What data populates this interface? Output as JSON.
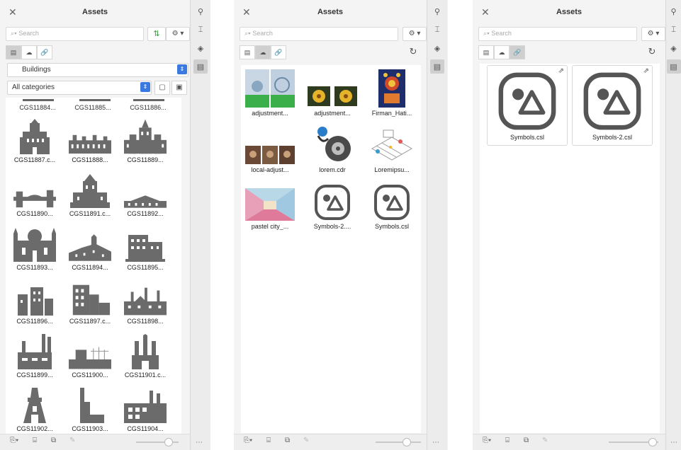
{
  "panels": [
    {
      "title": "Assets",
      "search_placeholder": "Search",
      "library_dropdown": "Buildings",
      "category_dropdown": "All categories",
      "header_row_labels": [
        "CGS11884...",
        "CGS11885...",
        "CGS11886..."
      ],
      "items": [
        "CGS11887.c...",
        "CGS11888...",
        "CGS11889...",
        "CGS11890...",
        "CGS11891.c...",
        "CGS11892...",
        "CGS11893...",
        "CGS11894...",
        "CGS11895...",
        "CGS11896...",
        "CGS11897.c...",
        "CGS11898...",
        "CGS11899...",
        "CGS11900...",
        "CGS11901.c...",
        "CGS11902...",
        "CGS11903...",
        "CGS11904..."
      ]
    },
    {
      "title": "Assets",
      "search_placeholder": "Search",
      "items": [
        "adjustment...",
        "adjustment...",
        "Firman_Hati...",
        "local-adjust...",
        "lorem.cdr",
        "Loremipsu...",
        "pastel city_...",
        "Symbols-2....",
        "Symbols.csl"
      ]
    },
    {
      "title": "Assets",
      "search_placeholder": "Search",
      "items": [
        "Symbols.csl",
        "Symbols-2.csl"
      ]
    }
  ],
  "strip_icons": [
    "pin-icon",
    "ruler-icon",
    "layers-icon",
    "assets-icon"
  ],
  "colors": {
    "accent": "#3a7ae0",
    "building": "#6b6b6b",
    "symbol": "#555555"
  }
}
